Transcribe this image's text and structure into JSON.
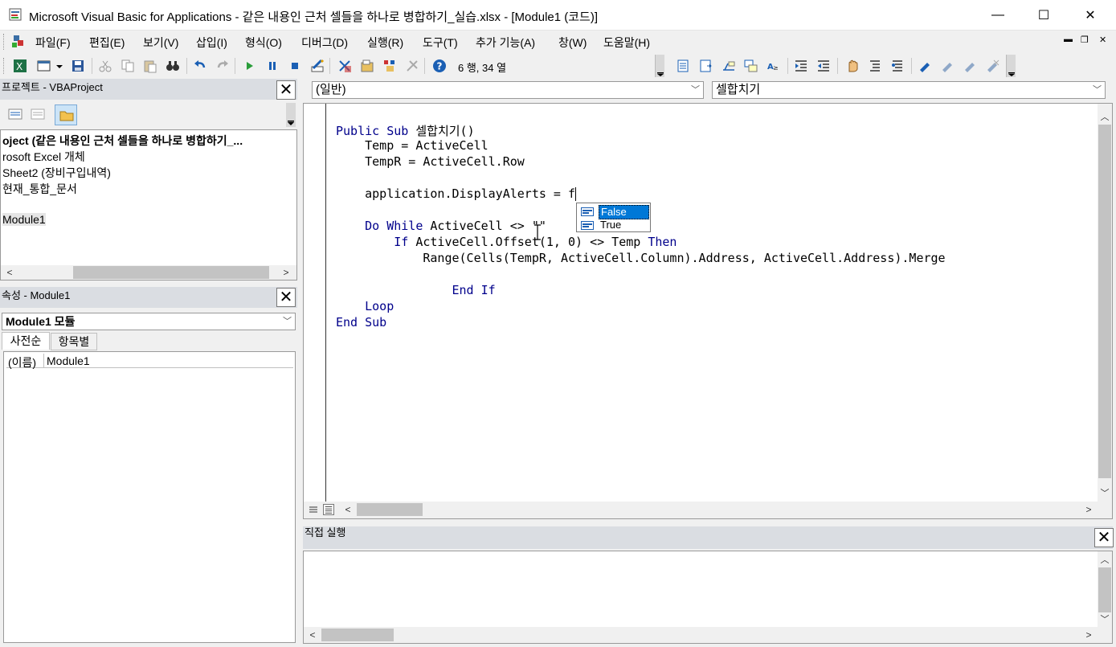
{
  "window": {
    "title": "Microsoft Visual Basic for Applications - 같은 내용인 근처 셀들을 하나로 병합하기_실습.xlsx - [Module1 (코드)]",
    "minimize": "—",
    "maximize": "☐",
    "close": "✕"
  },
  "menu": {
    "items": [
      "파일(F)",
      "편집(E)",
      "보기(V)",
      "삽입(I)",
      "형식(O)",
      "디버그(D)",
      "실행(R)",
      "도구(T)",
      "추가 기능(A)",
      "창(W)",
      "도움말(H)"
    ],
    "mdi_minimize": "▬",
    "mdi_restore": "❐",
    "mdi_close": "✕"
  },
  "toolbar": {
    "status": "6 행, 34 열"
  },
  "project": {
    "title": "프로젝트 - VBAProject",
    "tree": [
      "oject (같은 내용인 근처 셀들을 하나로 병합하기_...",
      "rosoft Excel 개체",
      "Sheet2 (장비구입내역)",
      "현재_통합_문서",
      "Module1"
    ]
  },
  "properties": {
    "title": "속성 - Module1",
    "object_select": "Module1 모듈",
    "tabs": [
      "사전순",
      "항목별"
    ],
    "rows": [
      {
        "name": "(이름)",
        "value": "Module1"
      }
    ]
  },
  "code": {
    "object_select": "(일반)",
    "procedure_select": "셀합치기",
    "lines": [
      "Public Sub 셀합치기()",
      "    Temp = ActiveCell",
      "    TempR = ActiveCell.Row",
      "",
      "    application.DisplayAlerts = f",
      "",
      "    Do While ActiveCell <> \"\"",
      "        If ActiveCell.Offset(1, 0) <> Temp Then",
      "            Range(Cells(TempR, ActiveCell.Column).Address, ActiveCell.Address).Merge",
      "",
      "        End If",
      "    Loop",
      "End Sub"
    ],
    "autocomplete": [
      "False",
      "True"
    ]
  },
  "immediate": {
    "title": "직접 실행"
  },
  "colors": {
    "keyword": "#00008b",
    "selection": "#0078d7",
    "panel_title": "#dadde2"
  }
}
